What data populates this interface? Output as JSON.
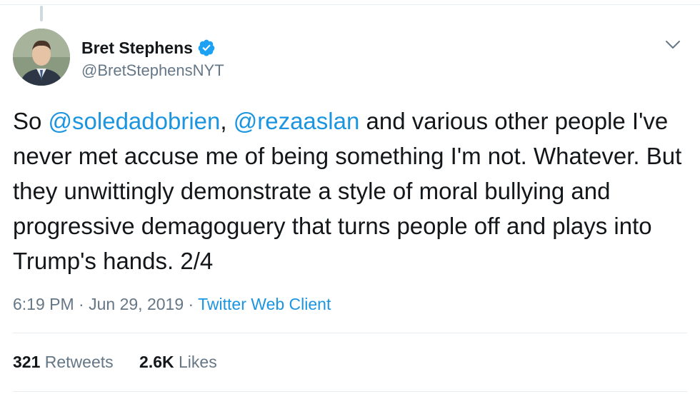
{
  "author": {
    "name": "Bret Stephens",
    "handle": "@BretStephensNYT",
    "verified_icon": "verified-badge-icon"
  },
  "tweet": {
    "prefix": "So ",
    "mention1": "@soledadobrien",
    "sep": ", ",
    "mention2": "@rezaaslan",
    "body": " and various other people I've never met accuse me of being something I'm not. Whatever. But they unwittingly demonstrate a style of moral bullying and progressive demagoguery that turns people off and plays into Trump's hands. 2/4"
  },
  "meta": {
    "time": "6:19 PM",
    "dot1": " · ",
    "date": "Jun 29, 2019",
    "dot2": " · ",
    "source": "Twitter Web Client"
  },
  "stats": {
    "retweets_count": "321",
    "retweets_label": "Retweets",
    "likes_count": "2.6K",
    "likes_label": "Likes"
  },
  "colors": {
    "link": "#1b95e0",
    "secondary_text": "#657786",
    "verified": "#1da1f2"
  }
}
